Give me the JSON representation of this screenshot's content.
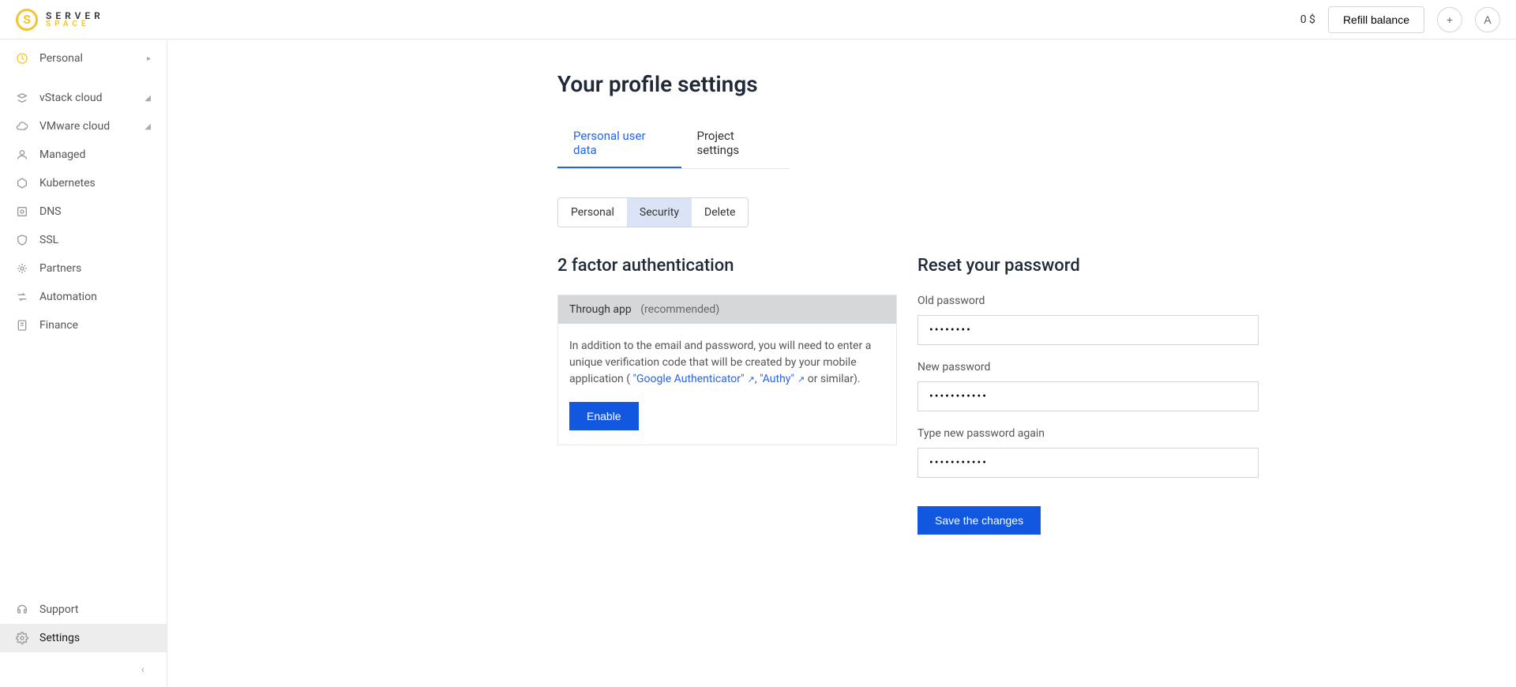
{
  "header": {
    "logo_top": "SERVER",
    "logo_bottom": "SPACE",
    "balance": "0 $",
    "refill_label": "Refill balance",
    "avatar_letter": "A"
  },
  "sidebar": {
    "personal": "Personal",
    "items": [
      {
        "label": "vStack cloud",
        "has_chevron": true
      },
      {
        "label": "VMware cloud",
        "has_chevron": true
      },
      {
        "label": "Managed"
      },
      {
        "label": "Kubernetes"
      },
      {
        "label": "DNS"
      },
      {
        "label": "SSL"
      },
      {
        "label": "Partners"
      },
      {
        "label": "Automation"
      },
      {
        "label": "Finance"
      }
    ],
    "bottom": {
      "support": "Support",
      "settings": "Settings"
    }
  },
  "page": {
    "title": "Your profile settings",
    "tabs": {
      "personal": "Personal user data",
      "project": "Project settings"
    },
    "subtabs": {
      "personal": "Personal",
      "security": "Security",
      "delete": "Delete"
    },
    "twofa": {
      "title": "2 factor authentication",
      "header_main": "Through app",
      "header_rec": "(recommended)",
      "body_pre": "In addition to the email and password, you will need to enter a unique verification code that will be created by your mobile application ( ",
      "link1": "\"Google Authenticator\"",
      "comma": ", ",
      "link2": "\"Authy\"",
      "body_post": " or similar).",
      "enable_btn": "Enable"
    },
    "reset": {
      "title": "Reset your password",
      "old_label": "Old password",
      "old_value": "••••••••",
      "new_label": "New password",
      "new_value": "•••••••••••",
      "again_label": "Type new password again",
      "again_value": "•••••••••••",
      "save_btn": "Save the changes"
    }
  }
}
